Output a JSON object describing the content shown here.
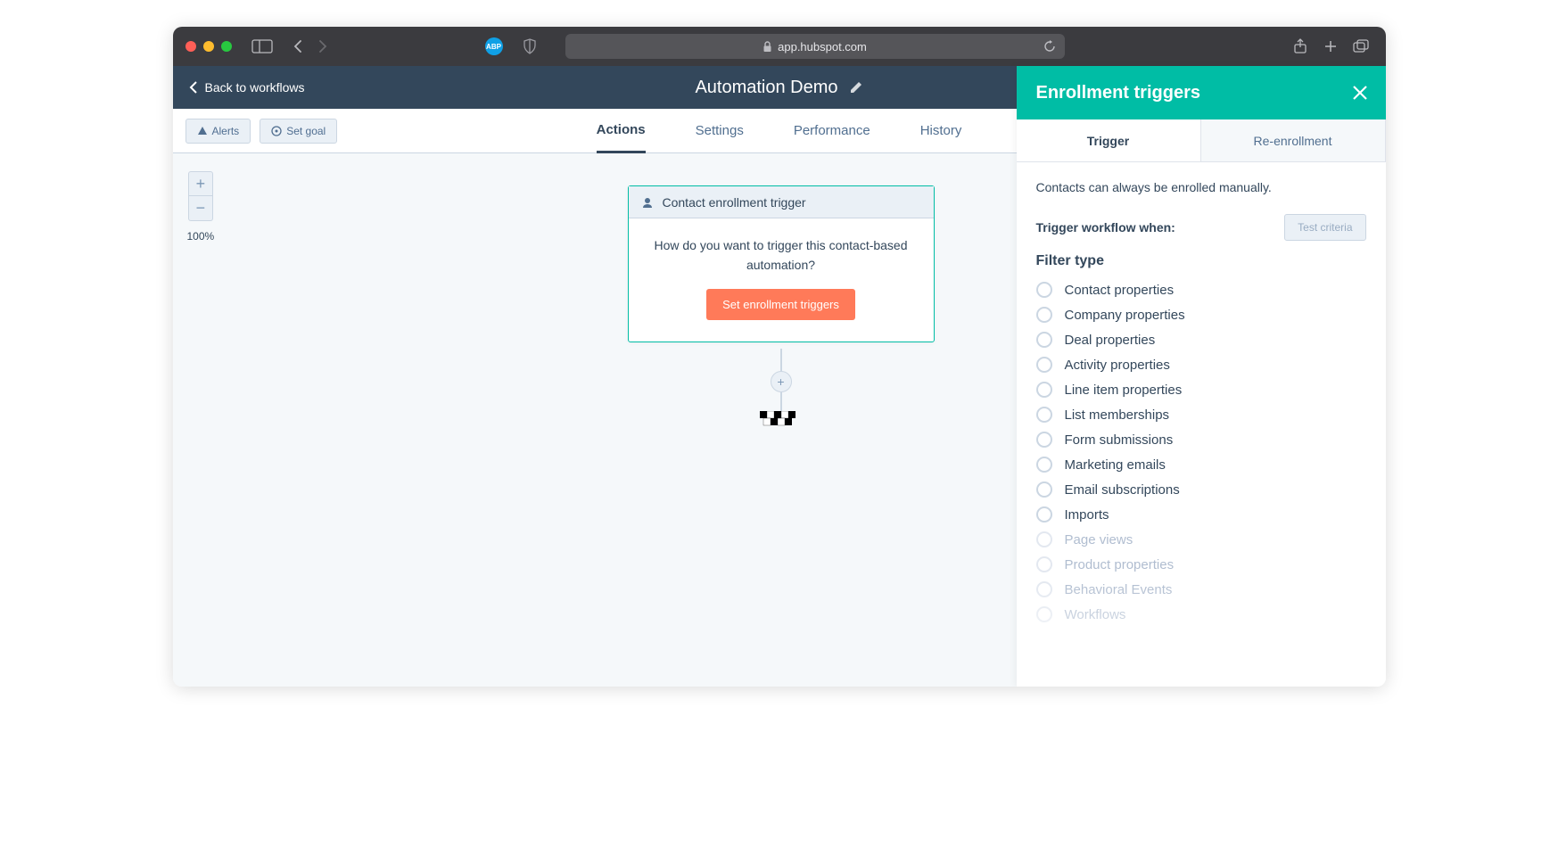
{
  "browser": {
    "url": "app.hubspot.com"
  },
  "header": {
    "back_label": "Back to workflows",
    "workflow_title": "Automation Demo"
  },
  "toolbar": {
    "alerts_label": "Alerts",
    "set_goal_label": "Set goal"
  },
  "tabs": [
    "Actions",
    "Settings",
    "Performance",
    "History"
  ],
  "zoom": {
    "level": "100%"
  },
  "trigger_card": {
    "header": "Contact enrollment trigger",
    "question": "How do you want to trigger this contact-based automation?",
    "button": "Set enrollment triggers"
  },
  "sidepanel": {
    "title": "Enrollment triggers",
    "tabs": [
      "Trigger",
      "Re-enrollment"
    ],
    "note": "Contacts can always be enrolled manually.",
    "trigger_when_label": "Trigger workflow when:",
    "test_criteria_label": "Test criteria",
    "filter_heading": "Filter type",
    "filters": [
      "Contact properties",
      "Company properties",
      "Deal properties",
      "Activity properties",
      "Line item properties",
      "List memberships",
      "Form submissions",
      "Marketing emails",
      "Email subscriptions",
      "Imports",
      "Page views",
      "Product properties",
      "Behavioral Events",
      "Workflows"
    ]
  }
}
